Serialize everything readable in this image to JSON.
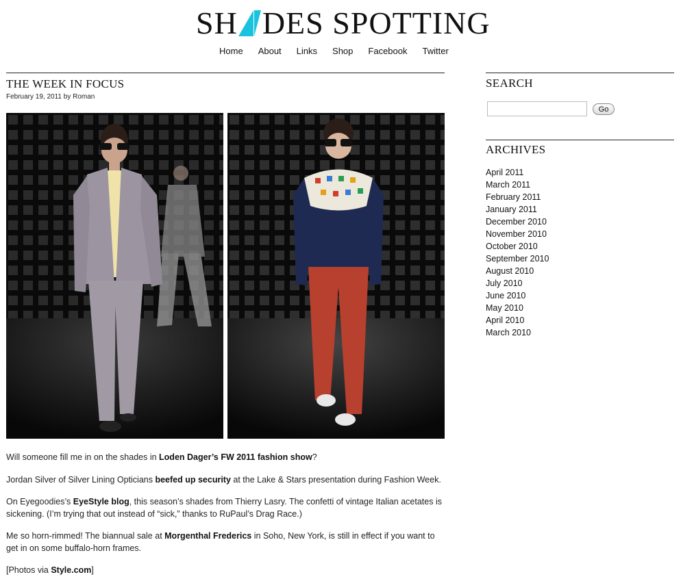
{
  "site": {
    "logo_left": "SH",
    "logo_right": "DES SPOTTING",
    "logo_accent": "#19c3dd"
  },
  "nav": [
    "Home",
    "About",
    "Links",
    "Shop",
    "Facebook",
    "Twitter"
  ],
  "post": {
    "title": "THE WEEK IN FOCUS",
    "date": "February 19, 2011",
    "by": "by",
    "author": "Roman",
    "photos": [
      {
        "subject": "runway-model-grey-suit"
      },
      {
        "subject": "runway-model-sweater-red-pants"
      }
    ],
    "paragraphs": [
      {
        "pre": "Will someone fill me in on the shades in ",
        "bold": "Loden Dager’s FW 2011 fashion show",
        "post": "?"
      },
      {
        "pre": "Jordan Silver of Silver Lining Opticians ",
        "bold": "beefed up security",
        "post": " at the Lake & Stars presentation during Fashion Week."
      },
      {
        "pre": "On Eyegoodies’s ",
        "bold": "EyeStyle blog",
        "post": ", this season’s shades from Thierry Lasry. The confetti of vintage Italian acetates is sickening. (I’m trying that out instead of “sick,” thanks to RuPaul’s Drag Race.)"
      },
      {
        "pre": "Me so horn-rimmed! The biannual sale at ",
        "bold": "Morgenthal Frederics",
        "post": " in Soho, New York, is still in effect if you want to get in on some buffalo-horn frames."
      },
      {
        "pre": "[Photos via ",
        "bold": "Style.com",
        "post": "]"
      }
    ]
  },
  "sidebar": {
    "search_heading": "SEARCH",
    "search_value": "",
    "go_label": "Go",
    "archives_heading": "ARCHIVES",
    "archives": [
      "April 2011",
      "March 2011",
      "February 2011",
      "January 2011",
      "December 2010",
      "November 2010",
      "October 2010",
      "September 2010",
      "August 2010",
      "July 2010",
      "June 2010",
      "May 2010",
      "April 2010",
      "March 2010"
    ]
  }
}
